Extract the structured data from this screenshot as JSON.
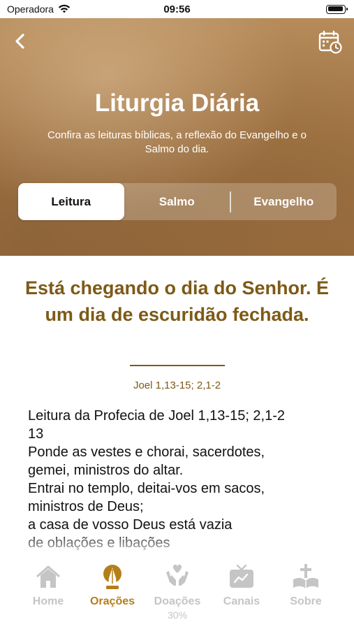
{
  "status_bar": {
    "carrier": "Operadora",
    "time": "09:56"
  },
  "header": {
    "title": "Liturgia Diária",
    "subtitle": "Confira as leituras bíblicas, a reflexão do Evangelho e o Salmo do dia.",
    "back_icon": "chevron-left-icon",
    "calendar_icon": "calendar-clock-icon"
  },
  "segments": [
    {
      "label": "Leitura",
      "active": true
    },
    {
      "label": "Salmo",
      "active": false
    },
    {
      "label": "Evangelho",
      "active": false
    }
  ],
  "reading": {
    "title": "Está chegando o dia do Senhor. É um dia de escuridão fechada.",
    "reference": "Joel 1,13-15; 2,1-2",
    "body": "Leitura da Profecia de Joel 1,13-15; 2,1-2\n13\nPonde as vestes e chorai, sacerdotes,\ngemei, ministros do altar.\nEntrai no templo, deitai-vos em sacos,\nministros de Deus;\na casa de vosso Deus está vazia\nde oblações e libações"
  },
  "tabbar": {
    "items": [
      {
        "label": "Home",
        "icon": "house-icon",
        "active": false
      },
      {
        "label": "Orações",
        "icon": "praying-hands-icon",
        "active": true
      },
      {
        "label": "Doações",
        "icon": "donation-heart-hands-icon",
        "active": false,
        "sub": "30%"
      },
      {
        "label": "Canais",
        "icon": "tv-icon",
        "active": false
      },
      {
        "label": "Sobre",
        "icon": "bible-cross-icon",
        "active": false
      }
    ]
  },
  "colors": {
    "accent": "#b47f1a",
    "reading_title": "#7d5a17",
    "inactive_tab": "#c5c5c5"
  }
}
